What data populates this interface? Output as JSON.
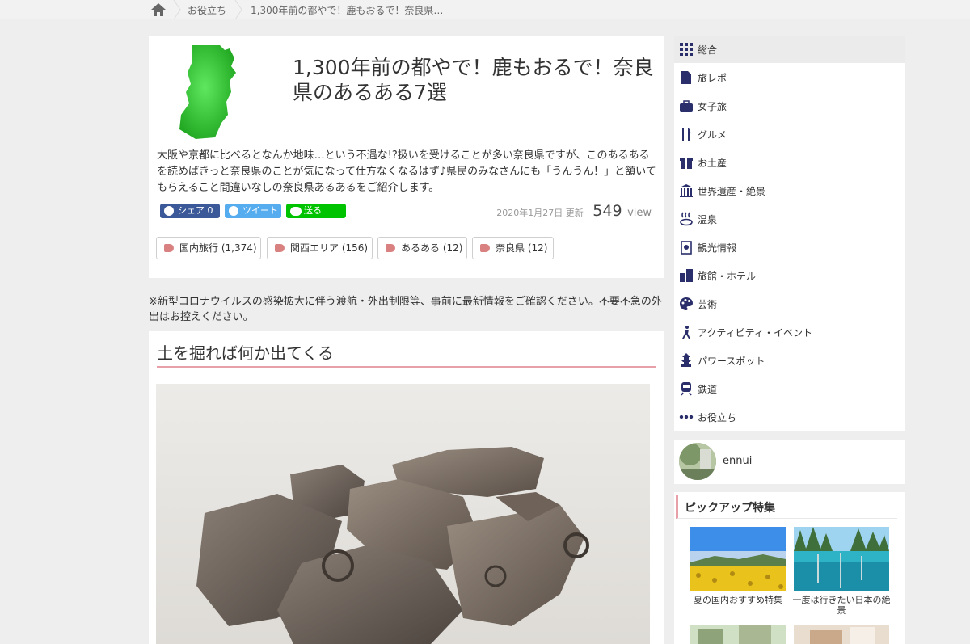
{
  "breadcrumb": {
    "home_icon": "home-icon",
    "items": [
      "お役立ち",
      "1,300年前の都やで！鹿もおるで！奈良県…"
    ]
  },
  "article": {
    "title": "1,300年前の都やで！鹿もおるで！奈良県のあるある7選",
    "lead": "大阪や京都に比べるとなんか地味…という不遇な!?扱いを受けることが多い奈良県ですが、このあるあるを読めばきっと奈良県のことが気になって仕方なくなるはず♪県民のみなさんにも「うんうん！」と頷いてもらえること間違いなしの奈良県あるあるをご紹介します。",
    "share": {
      "facebook": "シェア 0",
      "twitter": "ツイート",
      "line": "送る"
    },
    "updated_date": "2020年1月27日",
    "updated_label": "更新",
    "views": "549",
    "views_label": "view",
    "tags": [
      "国内旅行 (1,374)",
      "関西エリア (156)",
      "あるある (12)",
      "奈良県 (12)"
    ],
    "notice": "※新型コロナウイルスの感染拡大に伴う渡航・外出制限等、事前に最新情報をご確認ください。不要不急の外出はお控えください。",
    "section_title": "土を掘れば何か出てくる"
  },
  "sidebar": {
    "categories": [
      {
        "label": "総合",
        "icon": "grid-icon"
      },
      {
        "label": "旅レポ",
        "icon": "document-icon"
      },
      {
        "label": "女子旅",
        "icon": "bag-icon"
      },
      {
        "label": "グルメ",
        "icon": "fork-knife-icon"
      },
      {
        "label": "お土産",
        "icon": "gift-icon"
      },
      {
        "label": "世界遺産・絶景",
        "icon": "temple-icon"
      },
      {
        "label": "温泉",
        "icon": "hot-spring-icon"
      },
      {
        "label": "観光情報",
        "icon": "info-icon"
      },
      {
        "label": "旅館・ホテル",
        "icon": "building-icon"
      },
      {
        "label": "芸術",
        "icon": "palette-icon"
      },
      {
        "label": "アクティビティ・イベント",
        "icon": "activity-icon"
      },
      {
        "label": "パワースポット",
        "icon": "pagoda-icon"
      },
      {
        "label": "鉄道",
        "icon": "train-icon"
      },
      {
        "label": "お役立ち",
        "icon": "stars-icon"
      }
    ],
    "author": {
      "name": "ennui"
    },
    "pickup": {
      "title": "ピックアップ特集",
      "items": [
        {
          "label": "夏の国内おすすめ特集"
        },
        {
          "label": "一度は行きたい日本の絶景"
        }
      ]
    }
  },
  "colors": {
    "accent_pink": "#e8a0a8",
    "icon_navy": "#2a2f6b",
    "nara_green": "#3dc43d",
    "facebook": "#3b5998",
    "twitter": "#55acee",
    "line": "#00c300"
  }
}
